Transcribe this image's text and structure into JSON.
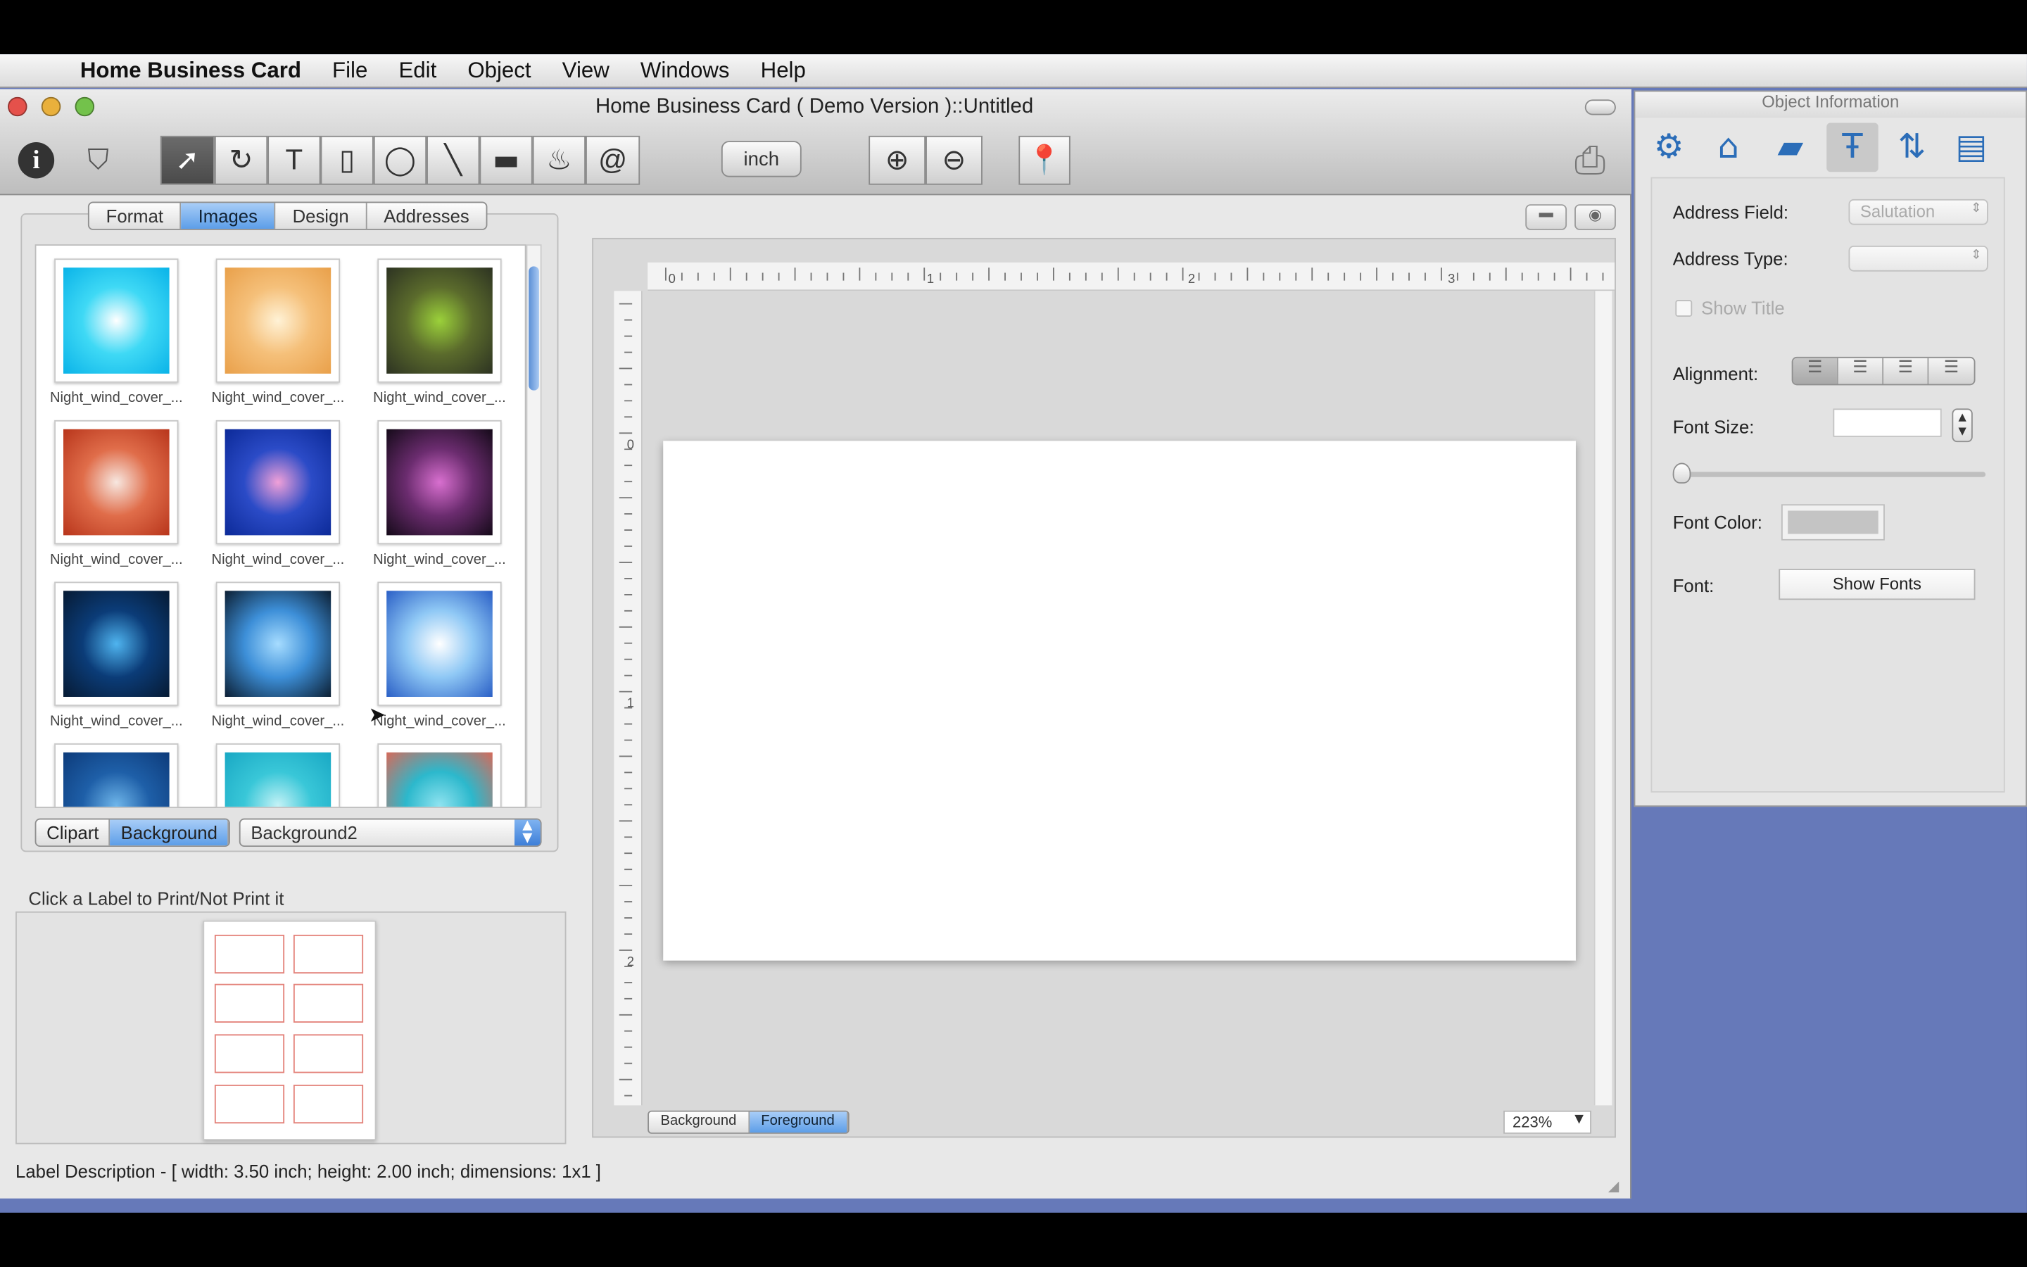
{
  "menubar": {
    "app_name": "Home Business Card",
    "items": [
      "File",
      "Edit",
      "Object",
      "View",
      "Windows",
      "Help"
    ]
  },
  "window": {
    "title": "Home Business Card ( Demo Version )::Untitled"
  },
  "toolbar": {
    "tools": [
      {
        "name": "info-icon",
        "glyph": "i"
      },
      {
        "name": "shield-icon",
        "glyph": "⛉"
      },
      {
        "name": "select-arrow-tool",
        "glyph": "➚"
      },
      {
        "name": "rotate-tool",
        "glyph": "↻"
      },
      {
        "name": "text-tool",
        "glyph": "T"
      },
      {
        "name": "rectangle-tool",
        "glyph": "▯"
      },
      {
        "name": "ellipse-tool",
        "glyph": "◯"
      },
      {
        "name": "line-tool",
        "glyph": "╲"
      },
      {
        "name": "barcode-tool",
        "glyph": "▬"
      },
      {
        "name": "fill-tool",
        "glyph": "♨"
      },
      {
        "name": "email-tool",
        "glyph": "@"
      }
    ],
    "unit_label": "inch",
    "zoom_in_glyph": "⊕",
    "zoom_out_glyph": "⊖",
    "pin_glyph": "📍",
    "print_glyph": "⎙"
  },
  "left_panel": {
    "tabs": [
      "Format",
      "Images",
      "Design",
      "Addresses"
    ],
    "selected_tab": "Images",
    "thumbnails": [
      {
        "caption": "Night_wind_cover_...",
        "colors": [
          "#ffffff",
          "#3fd9f5",
          "#0ab3e8"
        ]
      },
      {
        "caption": "Night_wind_cover_...",
        "colors": [
          "#fff2d6",
          "#f5c07a",
          "#e9a04a"
        ]
      },
      {
        "caption": "Night_wind_cover_...",
        "colors": [
          "#9bd13a",
          "#5b6b2c",
          "#2d3322"
        ]
      },
      {
        "caption": "Night_wind_cover_...",
        "colors": [
          "#f7e7e0",
          "#e06d4a",
          "#b8351b"
        ]
      },
      {
        "caption": "Night_wind_cover_...",
        "colors": [
          "#f0a0d8",
          "#2b4bc7",
          "#0c2a98"
        ]
      },
      {
        "caption": "Night_wind_cover_...",
        "colors": [
          "#d86fcf",
          "#6b2c6f",
          "#150a19"
        ]
      },
      {
        "caption": "Night_wind_cover_...",
        "colors": [
          "#4fb4ef",
          "#0b3c78",
          "#061a33"
        ]
      },
      {
        "caption": "Night_wind_cover_...",
        "colors": [
          "#a6dcff",
          "#3d8fd8",
          "#0c1f33"
        ]
      },
      {
        "caption": "Night_wind_cover_...",
        "colors": [
          "#ffffff",
          "#8fc8f5",
          "#2a5fc6"
        ]
      },
      {
        "caption": "",
        "colors": [
          "#6fb6ea",
          "#1e5fa8",
          "#0d3b7a"
        ]
      },
      {
        "caption": "",
        "colors": [
          "#c4f2f6",
          "#39c7d8",
          "#19a8c4"
        ]
      },
      {
        "caption": "",
        "colors": [
          "#8fe3f0",
          "#2cb8cc",
          "#d66a5a"
        ]
      }
    ],
    "image_source_tabs": [
      "Clipart",
      "Background"
    ],
    "selected_source": "Background",
    "category_select": "Background2",
    "print_hint": "Click a Label to Print/Not Print it",
    "status": "Label Description - [ width: 3.50 inch; height: 2.00 inch; dimensions: 1x1 ]"
  },
  "canvas": {
    "ruler_h_labels": [
      "0",
      "1",
      "2",
      "3"
    ],
    "ruler_v_labels": [
      "0",
      "1",
      "2"
    ],
    "layer_tabs": [
      "Background",
      "Foreground"
    ],
    "selected_layer": "Foreground",
    "zoom": "223%"
  },
  "inspector": {
    "title": "Object Information",
    "tab_icons": [
      "object-icon",
      "shape-icon",
      "image-icon",
      "text-icon",
      "position-icon",
      "layer-icon"
    ],
    "address_field_label": "Address Field:",
    "address_field_value": "Salutation",
    "address_type_label": "Address Type:",
    "address_type_value": "",
    "show_title_label": "Show Title",
    "alignment_label": "Alignment:",
    "font_size_label": "Font Size:",
    "font_color_label": "Font Color:",
    "font_label": "Font:",
    "show_fonts_button": "Show Fonts"
  }
}
